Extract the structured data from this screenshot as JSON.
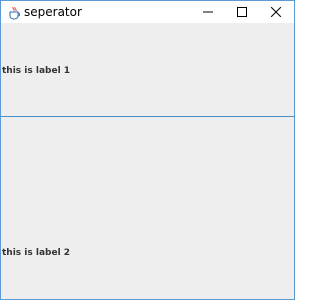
{
  "window": {
    "title": "seperator",
    "app_icon": "java-cup-icon",
    "controls": [
      "minimize-icon",
      "maximize-icon",
      "close-icon"
    ]
  },
  "content": {
    "label1": "this is label 1",
    "label2": "this is label 2"
  },
  "colors": {
    "window_border": "#5b9bd5",
    "content_background": "#eeeeee",
    "separator": "#4a90c8",
    "label_text": "#333333"
  }
}
